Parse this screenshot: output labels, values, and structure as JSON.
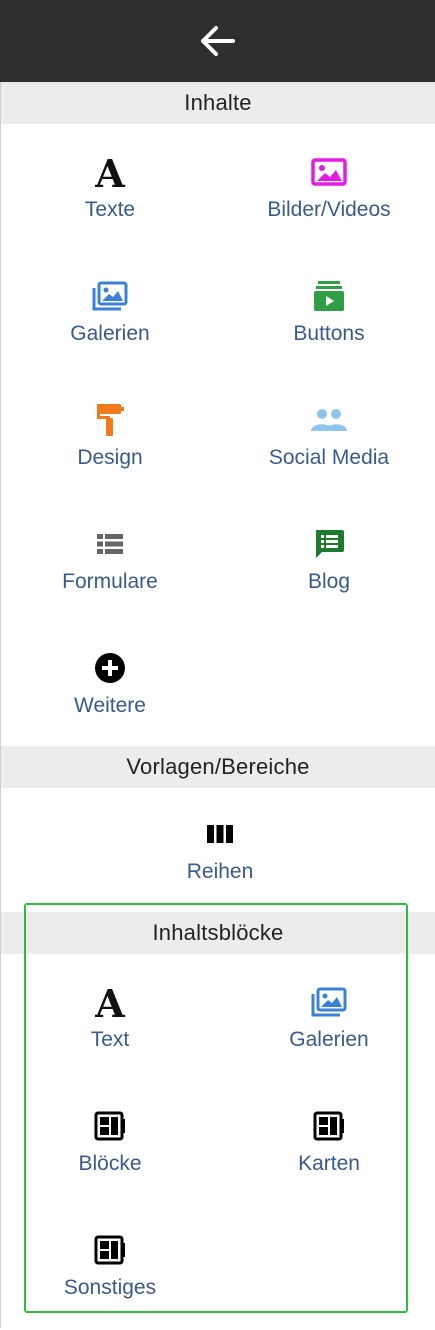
{
  "header": {
    "back_icon": "arrow-left-icon"
  },
  "sections": {
    "inhalte": {
      "title": "Inhalte",
      "items": [
        {
          "label": "Texte",
          "icon": "text-a-icon",
          "color": "#111111"
        },
        {
          "label": "Bilder/Videos",
          "icon": "image-icon",
          "color": "#e31be3"
        },
        {
          "label": "Galerien",
          "icon": "gallery-icon",
          "color": "#3b82d6"
        },
        {
          "label": "Buttons",
          "icon": "button-play-icon",
          "color": "#2f9e44"
        },
        {
          "label": "Design",
          "icon": "paint-roller-icon",
          "color": "#f07a1c"
        },
        {
          "label": "Social Media",
          "icon": "people-icon",
          "color": "#8ec5ef"
        },
        {
          "label": "Formulare",
          "icon": "form-list-icon",
          "color": "#666666"
        },
        {
          "label": "Blog",
          "icon": "chat-list-icon",
          "color": "#1f7a2e"
        },
        {
          "label": "Weitere",
          "icon": "plus-circle-icon",
          "color": "#000000"
        }
      ]
    },
    "vorlagen": {
      "title": "Vorlagen/Bereiche",
      "items": [
        {
          "label": "Reihen",
          "icon": "columns-icon",
          "color": "#000000"
        }
      ]
    },
    "inhaltsbloecke": {
      "title": "Inhaltsblöcke",
      "items": [
        {
          "label": "Text",
          "icon": "text-a-icon",
          "color": "#111111"
        },
        {
          "label": "Galerien",
          "icon": "gallery-icon",
          "color": "#3b82d6"
        },
        {
          "label": "Blöcke",
          "icon": "block-layout-icon",
          "color": "#000000"
        },
        {
          "label": "Karten",
          "icon": "block-layout-icon",
          "color": "#000000"
        },
        {
          "label": "Sonstiges",
          "icon": "block-layout-icon",
          "color": "#000000"
        }
      ]
    }
  },
  "colors": {
    "label": "#3a5a8c",
    "highlight": "#2ebd3f",
    "topbar": "#2f2f2f",
    "header_bg": "#ececec"
  }
}
